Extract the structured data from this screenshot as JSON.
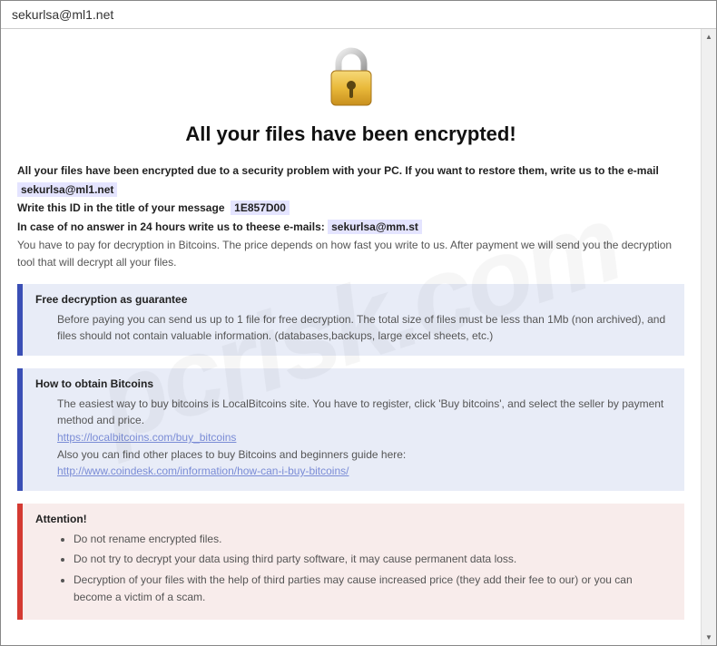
{
  "window": {
    "title": "sekurlsa@ml1.net"
  },
  "hero": {
    "icon": "lock-icon",
    "title": "All your files have been encrypted!"
  },
  "intro": {
    "line1": "All your files have been encrypted due to a security problem with your PC. If you want to restore them, write us to the e-mail",
    "email1": "sekurlsa@ml1.net",
    "line2_prefix": "Write this ID in the title of your message",
    "id_value": "1E857D00",
    "line3_prefix": "In case of no answer in 24 hours write us to theese e-mails:",
    "email2": "sekurlsa@mm.st",
    "line4": "You have to pay for decryption in Bitcoins. The price depends on how fast you write to us. After payment we will send you the decryption tool that will decrypt all your files."
  },
  "panel_guarantee": {
    "title": "Free decryption as guarantee",
    "body": "Before paying you can send us up to 1 file for free decryption. The total size of files must be less than 1Mb (non archived), and files should not contain valuable information. (databases,backups, large excel sheets, etc.)"
  },
  "panel_bitcoins": {
    "title": "How to obtain Bitcoins",
    "line1": "The easiest way to buy bitcoins is LocalBitcoins site. You have to register, click 'Buy bitcoins', and select the seller by payment method and price.",
    "link1": "https://localbitcoins.com/buy_bitcoins",
    "line2": "Also you can find other places to buy Bitcoins and beginners guide here:",
    "link2": "http://www.coindesk.com/information/how-can-i-buy-bitcoins/"
  },
  "panel_attention": {
    "title": "Attention!",
    "items": [
      "Do not rename encrypted files.",
      "Do not try to decrypt your data using third party software, it may cause permanent data loss.",
      "Decryption of your files with the help of third parties may cause increased price (they add their fee to our) or you can become a victim of a scam."
    ]
  },
  "watermark": "pcrisk.com"
}
